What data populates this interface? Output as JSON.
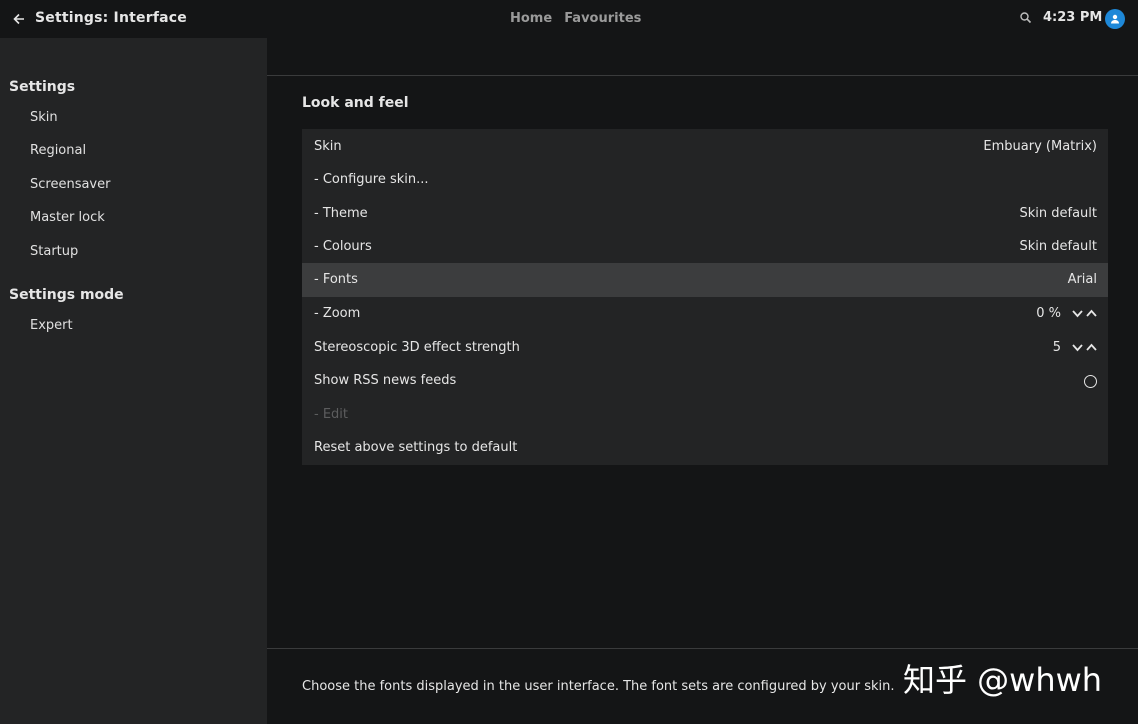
{
  "header": {
    "back_icon": "arrow-left-icon",
    "title": "Settings: Interface",
    "nav": [
      "Home",
      "Favourites"
    ],
    "search_icon": "search-icon",
    "time": "4:23 PM",
    "avatar_icon": "user-icon",
    "avatar_color": "#1e88d8"
  },
  "sidebar": {
    "groups": [
      {
        "heading": "Settings",
        "items": [
          "Skin",
          "Regional",
          "Screensaver",
          "Master lock",
          "Startup"
        ]
      },
      {
        "heading": "Settings mode",
        "items": [
          "Expert"
        ]
      }
    ]
  },
  "main": {
    "section_title": "Look and feel",
    "settings": [
      {
        "label": "Skin",
        "value": "Embuary (Matrix)"
      },
      {
        "label": "- Configure skin...",
        "value": ""
      },
      {
        "label": "- Theme",
        "value": "Skin default"
      },
      {
        "label": "- Colours",
        "value": "Skin default"
      },
      {
        "label": "- Fonts",
        "value": "Arial",
        "selected": true
      },
      {
        "label": "- Zoom",
        "value": "0 %",
        "spinner": true
      },
      {
        "label": "Stereoscopic 3D effect strength",
        "value": "5",
        "spinner": true
      },
      {
        "label": "Show RSS news feeds",
        "value": "",
        "toggle": "off"
      },
      {
        "label": "- Edit",
        "value": "",
        "disabled": true
      },
      {
        "label": "Reset above settings to default",
        "value": ""
      }
    ],
    "description": "Choose the fonts displayed in the user interface. The font sets are configured by your skin."
  },
  "watermark": "知乎 @whwh"
}
